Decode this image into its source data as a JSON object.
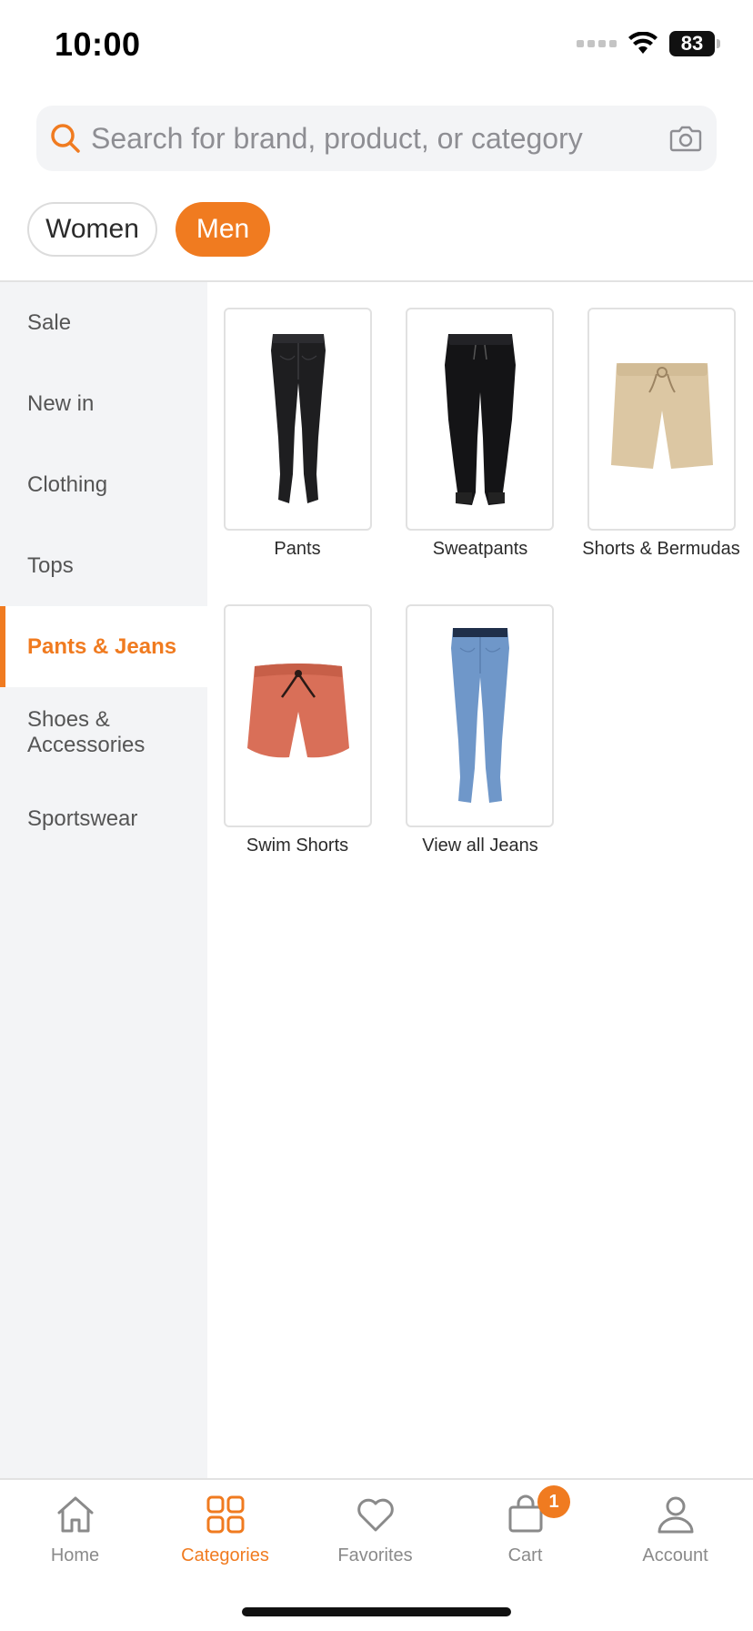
{
  "status_bar": {
    "time": "10:00",
    "battery": "83"
  },
  "search": {
    "placeholder": "Search for brand, product, or category"
  },
  "gender": {
    "women": "Women",
    "men": "Men",
    "selected": "Men"
  },
  "sidebar": {
    "items": [
      {
        "label": "Sale"
      },
      {
        "label": "New in"
      },
      {
        "label": "Clothing"
      },
      {
        "label": "Tops"
      },
      {
        "label": "Pants & Jeans"
      },
      {
        "label": "Shoes & Accessories"
      },
      {
        "label": "Sportswear"
      }
    ],
    "active": "Pants & Jeans"
  },
  "categories": [
    {
      "label": "Pants",
      "image": "black-skinny-jeans"
    },
    {
      "label": "Sweatpants",
      "image": "black-sweatpants"
    },
    {
      "label": "Shorts & Bermudas",
      "image": "beige-shorts"
    },
    {
      "label": "Swim Shorts",
      "image": "coral-swim-shorts"
    },
    {
      "label": "View all Jeans",
      "image": "blue-jeans"
    }
  ],
  "tabbar": {
    "items": [
      {
        "label": "Home",
        "icon": "home-icon"
      },
      {
        "label": "Categories",
        "icon": "grid-icon"
      },
      {
        "label": "Favorites",
        "icon": "heart-icon"
      },
      {
        "label": "Cart",
        "icon": "bag-icon",
        "badge": "1"
      },
      {
        "label": "Account",
        "icon": "user-icon"
      }
    ],
    "active": "Categories"
  },
  "colors": {
    "accent": "#f07b20",
    "sidebar_bg": "#f3f4f6",
    "text": "#2b2b2b",
    "muted": "#8a8a8a"
  }
}
